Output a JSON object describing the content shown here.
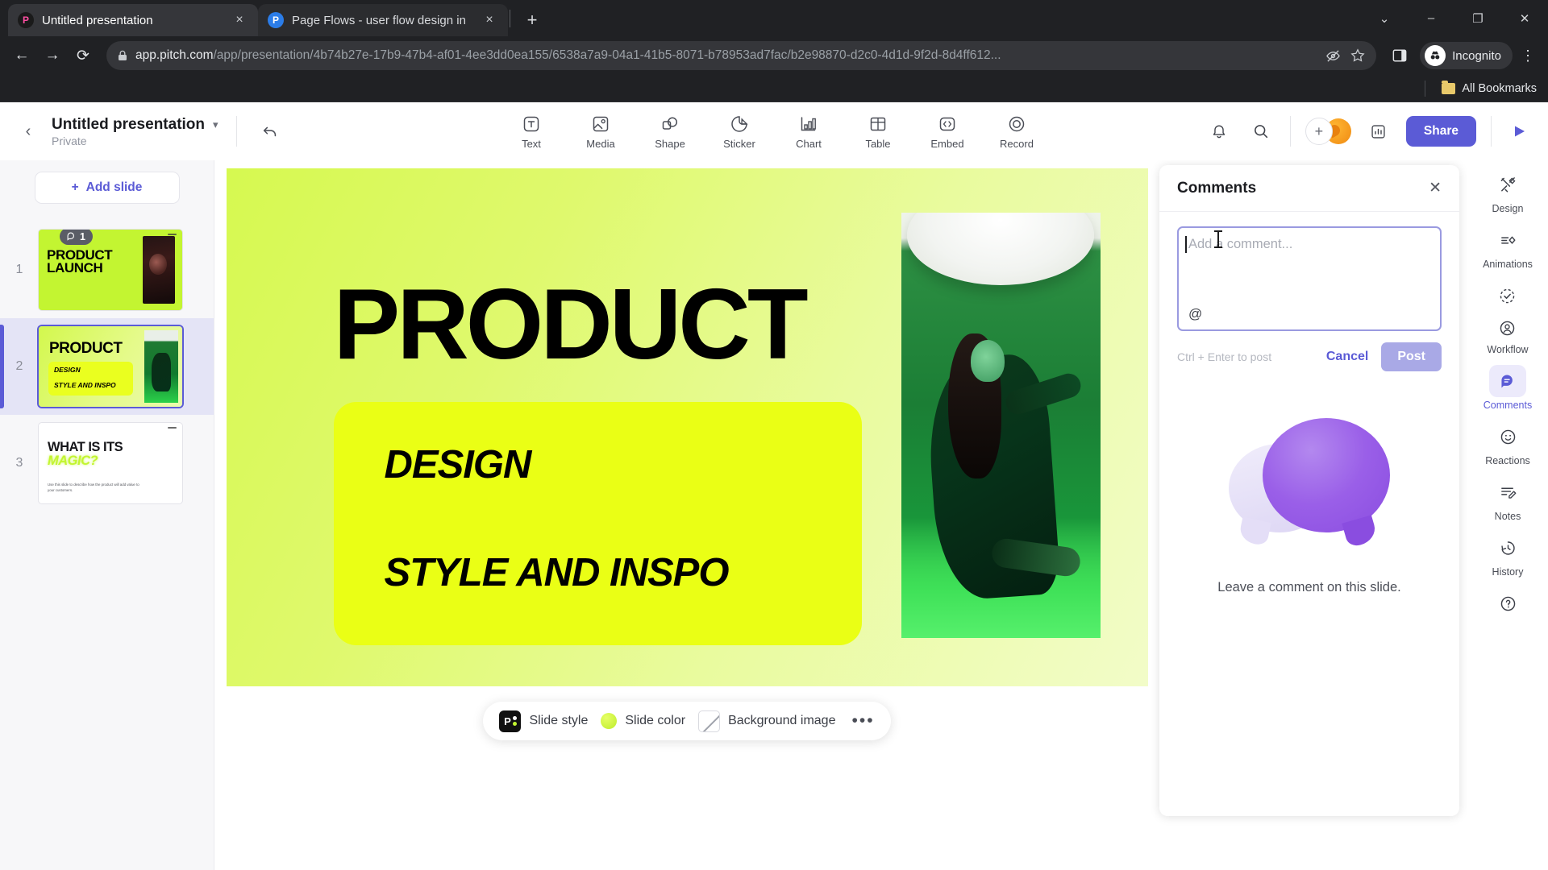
{
  "browser": {
    "tabs": [
      {
        "title": "Untitled presentation",
        "favicon": "pitch-favicon",
        "active": true,
        "close_label": "×"
      },
      {
        "title": "Page Flows - user flow design in",
        "favicon": "page-flows-favicon",
        "active": false,
        "close_label": "×"
      }
    ],
    "new_tab_label": "+",
    "window_controls": {
      "minimize": "–",
      "maximize": "❐",
      "close": "✕",
      "tab_search": "⌄"
    },
    "nav": {
      "back": "←",
      "forward": "→",
      "reload": "⟳"
    },
    "url_domain": "app.pitch.com",
    "url_path": "/app/presentation/4b74b27e-17b9-47b4-af01-4ee3dd0ea155/6538a7a9-04a1-41b5-8071-b78953ad7fac/b2e98870-d2c0-4d1d-9f2d-8d4ff612...",
    "profile_label": "Incognito",
    "bookmarks_label": "All Bookmarks"
  },
  "app": {
    "title": "Untitled presentation",
    "visibility": "Private",
    "tools": [
      {
        "label": "Text",
        "icon": "text-icon"
      },
      {
        "label": "Media",
        "icon": "media-icon"
      },
      {
        "label": "Shape",
        "icon": "shape-icon"
      },
      {
        "label": "Sticker",
        "icon": "sticker-icon"
      },
      {
        "label": "Chart",
        "icon": "chart-icon"
      },
      {
        "label": "Table",
        "icon": "table-icon"
      },
      {
        "label": "Embed",
        "icon": "embed-icon"
      },
      {
        "label": "Record",
        "icon": "record-icon"
      }
    ],
    "share_label": "Share",
    "add_slide_label": "Add slide"
  },
  "slides": [
    {
      "number": "1",
      "comment_badge": "1",
      "title_line1": "PRODUCT",
      "title_line2": "LAUNCH"
    },
    {
      "number": "2",
      "title": "PRODUCT",
      "sub1": "DESIGN",
      "sub2": "STYLE AND INSPO",
      "selected": true
    },
    {
      "number": "3",
      "title_line1": "WHAT IS ITS",
      "title_line2": "MAGIC?",
      "body": "Use this slide to describe how the product will add value to your customers."
    }
  ],
  "canvas": {
    "title": "PRODUCT",
    "sub1": "DESIGN",
    "sub2": "STYLE AND INSPO"
  },
  "slide_toolbar": {
    "slide_style": "Slide style",
    "slide_color": "Slide color",
    "background_image": "Background image",
    "more": "•••"
  },
  "comments": {
    "header": "Comments",
    "close": "✕",
    "placeholder": "Add a comment...",
    "mention_icon": "@",
    "hint": "Ctrl + Enter to post",
    "cancel_label": "Cancel",
    "post_label": "Post",
    "empty_text": "Leave a comment on this slide."
  },
  "right_rail": [
    {
      "label": "Design",
      "icon": "design-icon",
      "active": false
    },
    {
      "label": "Animations",
      "icon": "animations-icon",
      "active": false
    },
    {
      "label": "Workflow",
      "icon": "workflow-icon",
      "active": false
    },
    {
      "label": "Comments",
      "icon": "comments-icon",
      "active": true
    },
    {
      "label": "Reactions",
      "icon": "reactions-icon",
      "active": false
    },
    {
      "label": "Notes",
      "icon": "notes-icon",
      "active": false
    },
    {
      "label": "History",
      "icon": "history-icon",
      "active": false
    }
  ],
  "colors": {
    "accent": "#5b5bd6",
    "slide_bg": "#d6f950",
    "slide_yellow": "#eaff15"
  }
}
